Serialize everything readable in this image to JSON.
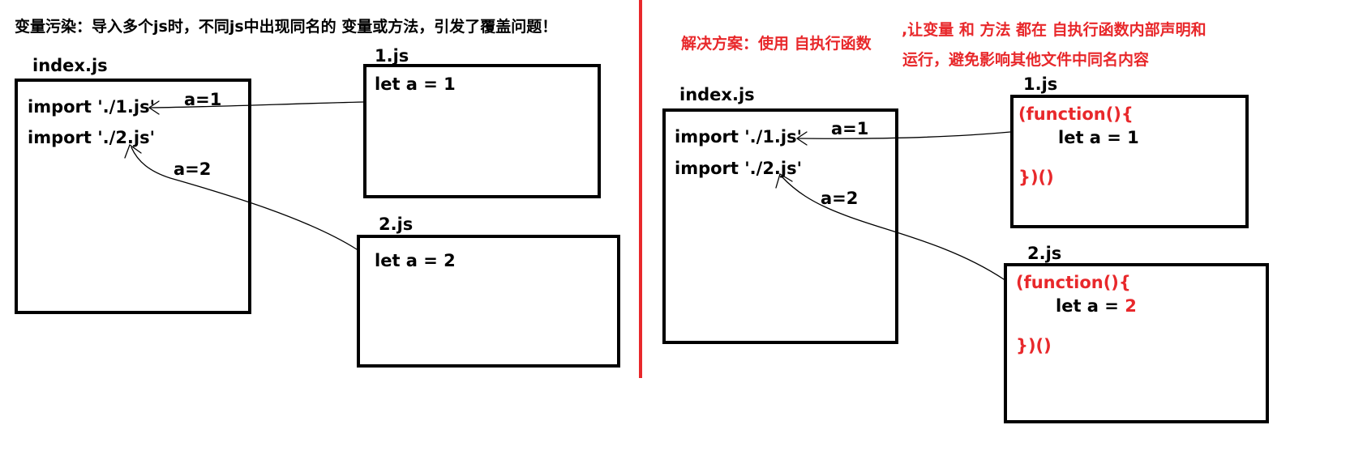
{
  "colors": {
    "ink": "#000000",
    "accent": "#e8282b"
  },
  "problem": {
    "heading": "变量污染：导入多个js时，不同js中出现同名的 变量或方法，引发了覆盖问题！",
    "index": {
      "label": "index.js",
      "import1": "import './1.js'",
      "import2": "import './2.js'"
    },
    "file1": {
      "label": "1.js",
      "code": "let a = 1"
    },
    "file2": {
      "label": "2.js",
      "code": "let a = 2"
    },
    "arrow1_label": "a=1",
    "arrow2_label": "a=2"
  },
  "solution": {
    "heading_part1": "解决方案：使用 自执行函数",
    "heading_part2_line1": ",让变量 和 方法 都在 自执行函数内部声明和",
    "heading_part2_line2": "运行，避免影响其他文件中同名内容",
    "index": {
      "label": "index.js",
      "import1": "import './1.js'",
      "import2": "import './2.js'"
    },
    "file1": {
      "label": "1.js",
      "open": "(function(){",
      "code": "let a = 1",
      "close": "})()"
    },
    "file2": {
      "label": "2.js",
      "open": "(function(){",
      "code_prefix": "let a = ",
      "code_value": "2",
      "close": "})()"
    },
    "arrow1_label": "a=1",
    "arrow2_label": "a=2"
  }
}
